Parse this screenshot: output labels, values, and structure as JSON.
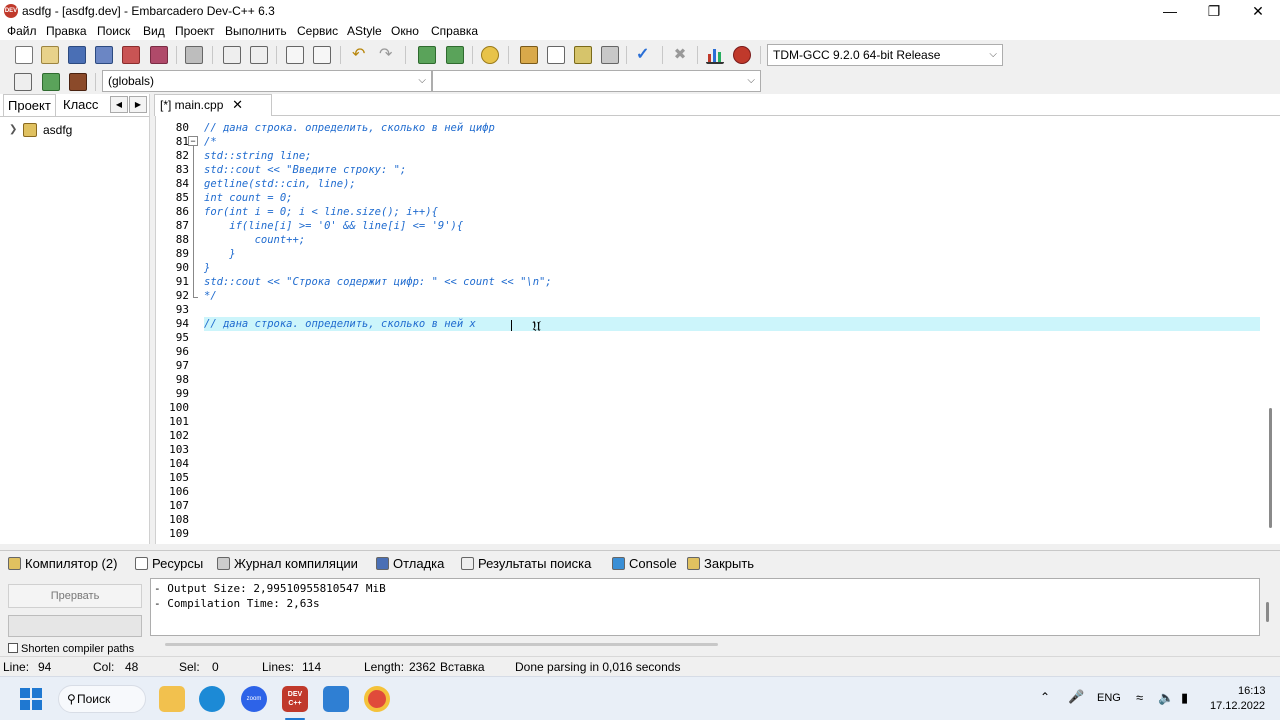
{
  "window": {
    "title": "asdfg - [asdfg.dev] - Embarcadero Dev-C++ 6.3",
    "app_icon_text": "DEV"
  },
  "menu": [
    "Файл",
    "Правка",
    "Поиск",
    "Вид",
    "Проект",
    "Выполнить",
    "Сервис",
    "AStyle",
    "Окно",
    "Справка"
  ],
  "toolbar": {
    "compiler_select": "TDM-GCC 9.2.0 64-bit Release",
    "scope_select": "(globals)",
    "member_select": ""
  },
  "left_panel": {
    "tab_project": "Проект",
    "tab_classes": "Класс",
    "tree_root": "asdfg"
  },
  "editor": {
    "tab_label": "[*] main.cpp",
    "line_numbers": [
      "80",
      "81",
      "82",
      "83",
      "84",
      "85",
      "86",
      "87",
      "88",
      "89",
      "90",
      "91",
      "92",
      "93",
      "94",
      "95",
      "96",
      "97",
      "98",
      "99",
      "100",
      "101",
      "102",
      "103",
      "104",
      "105",
      "106",
      "107",
      "108",
      "109"
    ],
    "lines": [
      "// дана строка. определить, сколько в ней цифр",
      "/*",
      "std::string line;",
      "std::cout << \"Введите строку: \";",
      "getline(std::cin, line);",
      "int count = 0;",
      "for(int i = 0; i < line.size(); i++){",
      "    if(line[i] >= '0' && line[i] <= '9'){",
      "        count++;",
      "    }",
      "}",
      "std::cout << \"Строка содержит цифр: \" << count << \"\\n\";",
      "*/",
      "",
      "// дана строка. определить, сколько в ней х",
      "",
      "",
      "",
      "",
      "",
      "",
      "",
      "",
      "",
      "",
      "",
      "",
      "",
      "",
      ""
    ],
    "active_line_index": 14
  },
  "bottom_tabs": [
    "Компилятор (2)",
    "Ресурсы",
    "Журнал компиляции",
    "Отладка",
    "Результаты поиска",
    "Console",
    "Закрыть"
  ],
  "compile_log": {
    "abort_button": "Прервать",
    "shorten_paths": "Shorten compiler paths",
    "output_lines": [
      "- Output Size: 2,99510955810547 MiB",
      "- Compilation Time: 2,63s"
    ]
  },
  "status": {
    "line_label": "Line:",
    "line_value": "94",
    "col_label": "Col:",
    "col_value": "48",
    "sel_label": "Sel:",
    "sel_value": "0",
    "lines_label": "Lines:",
    "lines_value": "114",
    "length_label": "Length:",
    "length_value": "2362",
    "mode": "Вставка",
    "message": "Done parsing in 0,016 seconds"
  },
  "taskbar": {
    "search_label": "Поиск",
    "language": "ENG",
    "time": "16:13",
    "date": "17.12.2022",
    "zoom_label": "zoom",
    "devcpp_label": "DEV C++"
  }
}
